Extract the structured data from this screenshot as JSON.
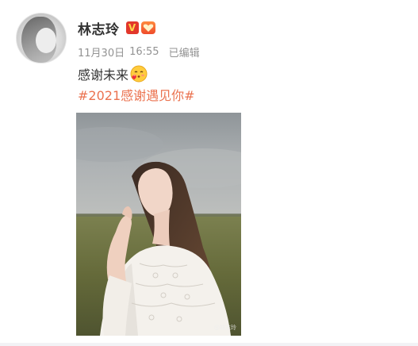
{
  "post": {
    "user_name": "林志玲",
    "verified_badge": "V",
    "level_badge": "icon-level",
    "date": "11月30日",
    "time": "16:55",
    "edited": "已编辑",
    "text": "感谢未来",
    "emoji": "blush-heart-emoji",
    "hashtag": "#2021感谢遇见你#",
    "image_watermark": "@林志玲"
  },
  "colors": {
    "text": "#333333",
    "meta": "#939393",
    "hashtag": "#eb7350",
    "verified": "#e2372b"
  }
}
